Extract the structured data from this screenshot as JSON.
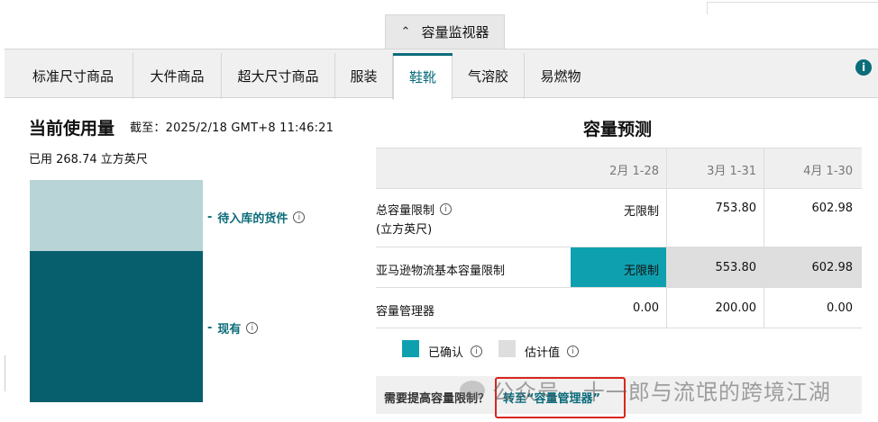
{
  "monitor_tab": {
    "label": "容量监视器",
    "icon": "chevron-up-icon"
  },
  "tabs": [
    {
      "label": "标准尺寸商品",
      "active": false
    },
    {
      "label": "大件商品",
      "active": false
    },
    {
      "label": "超大尺寸商品",
      "active": false
    },
    {
      "label": "服装",
      "active": false
    },
    {
      "label": "鞋靴",
      "active": true
    },
    {
      "label": "气溶胶",
      "active": false
    },
    {
      "label": "易燃物",
      "active": false
    }
  ],
  "info_icon": "i",
  "current_usage": {
    "title": "当前使用量",
    "as_of": "截至：2025/2/18 GMT+8 11:46:21",
    "used": "已用 268.74 立方英尺",
    "legend": {
      "inbound": "待入库的货件",
      "on_hand": "现有"
    }
  },
  "forecast": {
    "title": "容量预测",
    "columns": [
      "2月 1-28",
      "3月 1-31",
      "4月 1-30"
    ],
    "rows": [
      {
        "label_line1": "总容量限制",
        "label_line2": "(立方英尺)",
        "values": [
          "无限制",
          "753.80",
          "602.98"
        ]
      },
      {
        "label_line1": "亚马逊物流基本容量限制",
        "values": [
          "无限制",
          "553.80",
          "602.98"
        ]
      },
      {
        "label_line1": "容量管理器",
        "values": [
          "0.00",
          "200.00",
          "0.00"
        ]
      }
    ],
    "legend": {
      "confirmed": "已确认",
      "estimated": "估计值"
    },
    "need_more": "需要提高容量限制？",
    "goto_link": "转至“容量管理器”"
  },
  "watermark": "公众号 · 十一郎与流氓的跨境江湖",
  "colors": {
    "accent": "#0b6c7a",
    "confirmed": "#0fa0b0",
    "estimated": "#dedede",
    "highlight_box": "#d9261c"
  }
}
